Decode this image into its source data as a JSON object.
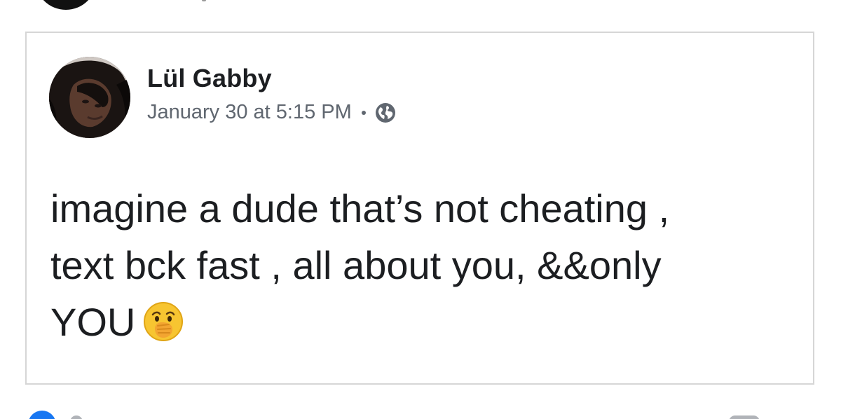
{
  "post": {
    "author": "Lül Gabby",
    "timestamp": "January 30 at 5:15 PM",
    "privacy_icon": "globe-icon",
    "text_lines": [
      "imagine a dude that’s not cheating ,",
      "text bck fast , all about you, &&only",
      "YOU"
    ],
    "emoji": "face-with-hand-over-mouth-emoji"
  },
  "colors": {
    "text_primary": "#1c1e21",
    "text_secondary": "#606770",
    "card_border": "#d6d6d6",
    "accent_blue": "#1877f2"
  }
}
